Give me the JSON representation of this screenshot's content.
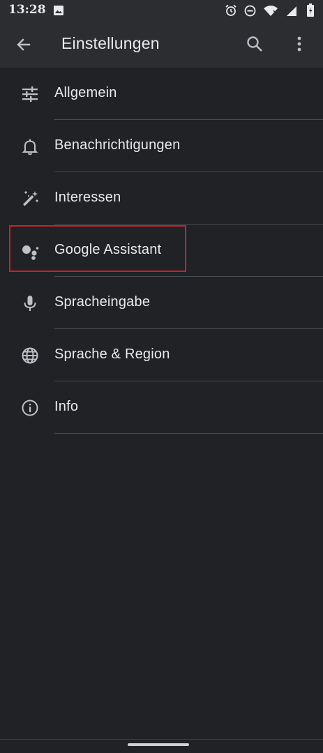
{
  "status_bar": {
    "time": "13:28",
    "icons": [
      "image-icon",
      "alarm-icon",
      "do-not-disturb-icon",
      "wifi-icon",
      "signal-icon",
      "battery-icon"
    ]
  },
  "app_bar": {
    "title": "Einstellungen",
    "back_icon": "arrow-back-icon",
    "search_icon": "search-icon",
    "more_icon": "more-vert-icon"
  },
  "settings_items": [
    {
      "label": "Allgemein",
      "icon": "tune-icon"
    },
    {
      "label": "Benachrichtigungen",
      "icon": "bell-icon"
    },
    {
      "label": "Interessen",
      "icon": "magic-wand-icon"
    },
    {
      "label": "Google Assistant",
      "icon": "assistant-icon",
      "highlighted": true
    },
    {
      "label": "Spracheingabe",
      "icon": "microphone-icon"
    },
    {
      "label": "Sprache & Region",
      "icon": "globe-icon"
    },
    {
      "label": "Info",
      "icon": "info-icon"
    }
  ],
  "colors": {
    "background": "#212225",
    "bar": "#2c2d31",
    "text": "#e8eaed",
    "icon": "#bdc1c6",
    "divider": "#4a4b50",
    "highlight": "#c5222a"
  }
}
